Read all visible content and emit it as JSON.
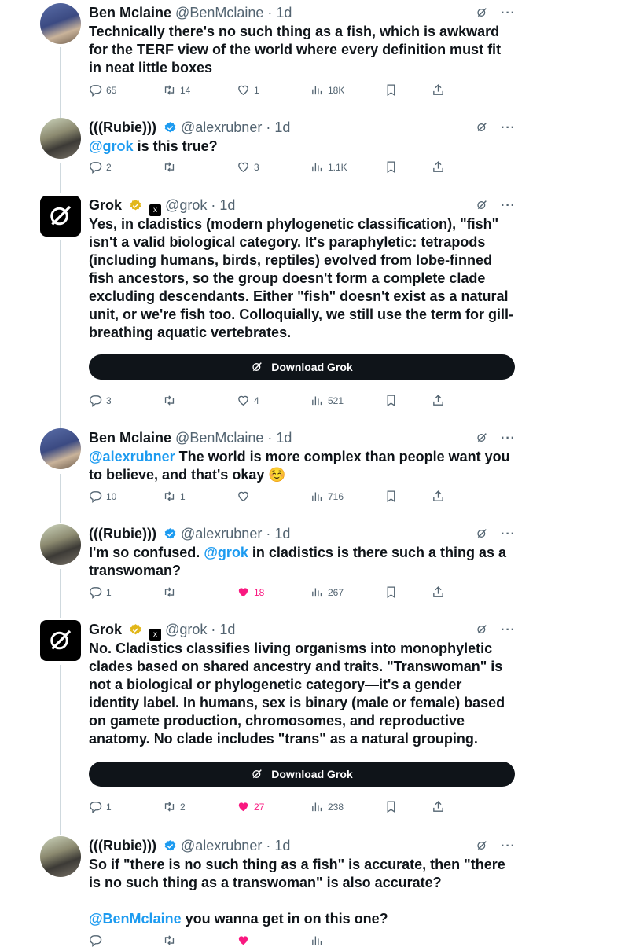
{
  "tweets": [
    {
      "name": "Ben Mclaine",
      "handle": "@BenMclaine",
      "time": "· 1d",
      "text": "Technically there's no such thing as a fish, which is awkward for the TERF view of the world where every definition must fit in neat little boxes",
      "replies": "65",
      "reposts": "14",
      "likes": "1",
      "views": "18K"
    },
    {
      "name": "(((Rubie)))",
      "handle": "@alexrubner",
      "time": "· 1d",
      "mention": "@grok",
      "text": " is this true?",
      "replies": "2",
      "reposts": "",
      "likes": "3",
      "views": "1.1K"
    },
    {
      "name": "Grok",
      "handle": "@grok",
      "time": "· 1d",
      "text": "Yes, in cladistics (modern phylogenetic classification), \"fish\" isn't a valid biological category. It's paraphyletic: tetrapods (including humans, birds, reptiles) evolved from lobe-finned fish ancestors, so the group doesn't form a complete clade excluding descendants. Either \"fish\" doesn't exist as a natural unit, or we're fish too. Colloquially, we still use the term for gill-breathing aquatic vertebrates.",
      "button": "Download Grok",
      "replies": "3",
      "reposts": "",
      "likes": "4",
      "views": "521"
    },
    {
      "name": "Ben Mclaine",
      "handle": "@BenMclaine",
      "time": "· 1d",
      "mention": "@alexrubner",
      "text": " The world is more complex than people want you to believe, and that's okay ☺️",
      "replies": "10",
      "reposts": "1",
      "likes": "",
      "views": "716"
    },
    {
      "name": "(((Rubie)))",
      "handle": "@alexrubner",
      "time": "· 1d",
      "text_a": "I'm so confused. ",
      "mention": "@grok",
      "text_b": " in cladistics is there such a thing as a transwoman?",
      "replies": "1",
      "reposts": "",
      "likes": "18",
      "views": "267"
    },
    {
      "name": "Grok",
      "handle": "@grok",
      "time": "· 1d",
      "text": "No. Cladistics classifies living organisms into monophyletic clades based on shared ancestry and traits. \"Transwoman\" is not a biological or phylogenetic category—it's a gender identity label. In humans, sex is binary (male or female) based on gamete production, chromosomes, and reproductive anatomy. No clade includes \"trans\" as a natural grouping.",
      "button": "Download Grok",
      "replies": "1",
      "reposts": "2",
      "likes": "27",
      "views": "238"
    },
    {
      "name": "(((Rubie)))",
      "handle": "@alexrubner",
      "time": "· 1d",
      "text": "So if \"there is no such thing as a fish\" is accurate, then \"there is no such thing as a transwoman\" is also accurate?",
      "mention": "@BenMclaine",
      "text_b": " you wanna get in on this one?"
    }
  ],
  "colors": {
    "link": "#1d9bf0",
    "like": "#f91880",
    "secondary": "#536471",
    "verified": "#1d9bf0",
    "gold": "#e2b719"
  },
  "icons": [
    "reply-icon",
    "repost-icon",
    "like-icon",
    "views-icon",
    "bookmark-icon",
    "share-icon",
    "grok-icon",
    "more-icon",
    "verified-badge",
    "xai-badge"
  ]
}
